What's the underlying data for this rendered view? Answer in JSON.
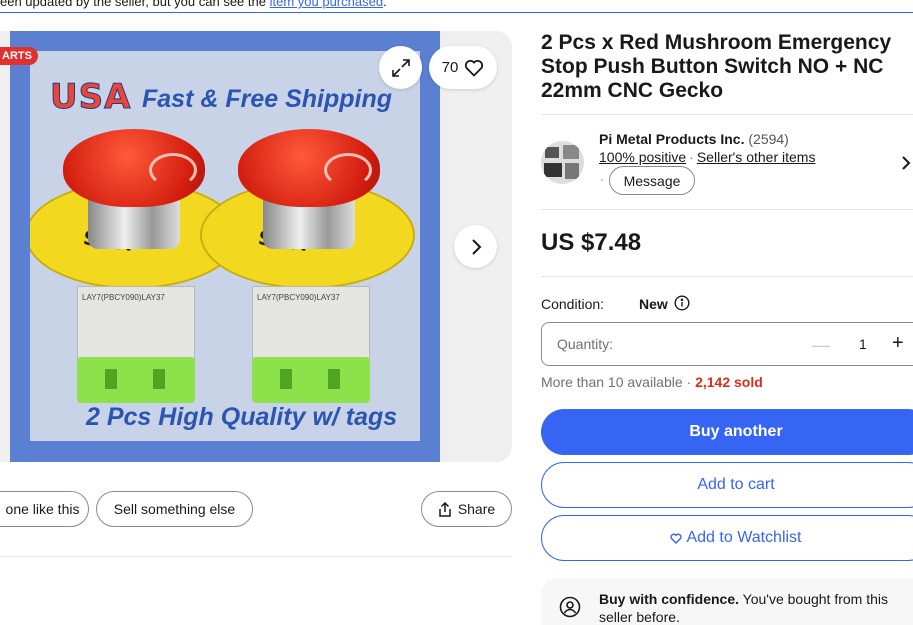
{
  "notice": {
    "text": "een updated by the seller, but you can see the ",
    "link": "item you purchased",
    "tail": "."
  },
  "gallery": {
    "badge": "ARTS",
    "image_banner_flag": "USA",
    "image_banner_text": "Fast & Free Shipping",
    "image_caption": "2 Pcs High Quality w/ tags",
    "switch_ring_word": "STOP",
    "switch_body_label": "LAY7(PBCY090)LAY37",
    "watch_count": "70",
    "icons": {
      "expand": "expand-icon",
      "heart": "heart-icon",
      "next": "chevron-right-icon"
    }
  },
  "actions": {
    "similar_label": "one like this",
    "sell_label": "Sell something else",
    "share_label": "Share"
  },
  "listing": {
    "title": "2 Pcs x Red Mushroom Emergency Stop Push Button Switch NO + NC 22mm CNC Gecko",
    "price": "US $7.48",
    "condition_label": "Condition:",
    "condition_value": "New",
    "quantity_label": "Quantity:",
    "quantity_value": "1",
    "availability": "More than 10 available · ",
    "sold": "2,142 sold"
  },
  "seller": {
    "name": "Pi Metal Products Inc.",
    "feedback_count": "(2594)",
    "positive": "100% positive",
    "other_items": "Seller's other items",
    "message": "Message"
  },
  "buttons": {
    "buy": "Buy another",
    "cart": "Add to cart",
    "watchlist": "Add to Watchlist"
  },
  "confidence": {
    "bold": "Buy with confidence.",
    "text": " You've bought from this seller before."
  },
  "colors": {
    "accent": "#3665f3",
    "sold": "#d92e1d",
    "badge": "#e0312f"
  }
}
